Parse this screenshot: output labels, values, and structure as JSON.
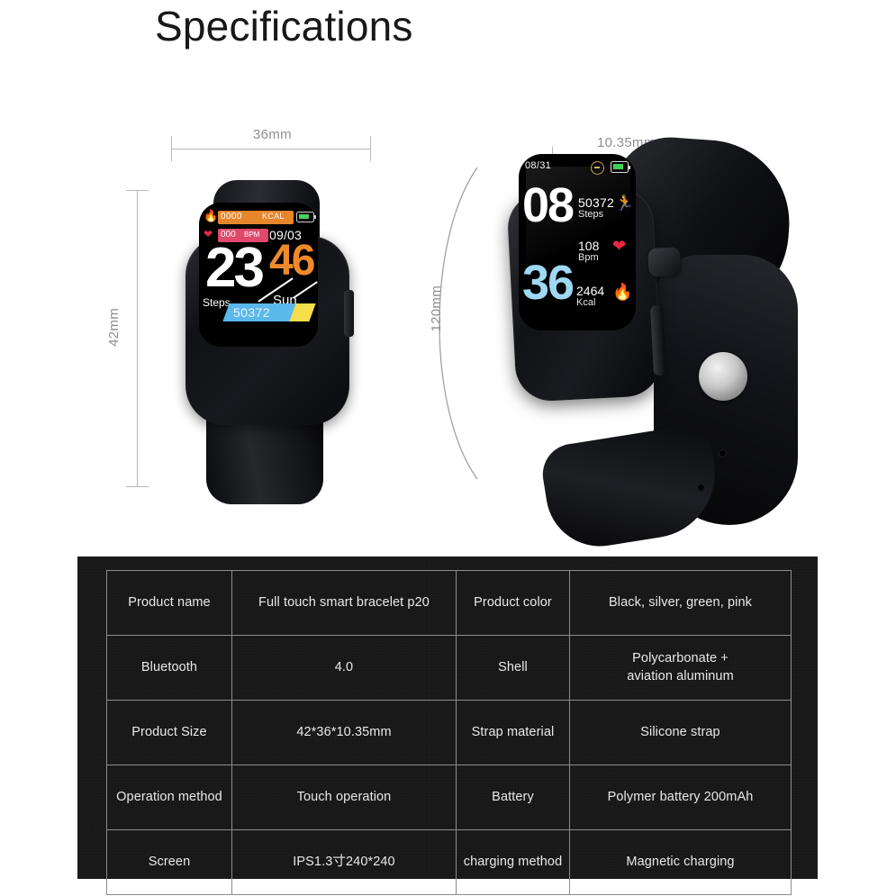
{
  "page": {
    "title": "Specifications",
    "background_color": "#ffffff",
    "panel_color": "#171717"
  },
  "dimensions": {
    "front_width": "36mm",
    "front_height": "42mm",
    "side_thickness": "10.35mm",
    "strap_length": "120mm"
  },
  "watch_front": {
    "kcal_value": "0000",
    "kcal_unit": "KCAL",
    "bpm_value": "000",
    "bpm_unit": "BPM",
    "date": "09/03",
    "hour": "23",
    "minute": "46",
    "weekday": "Sun",
    "steps_label": "Steps",
    "steps_value": "50372",
    "flame_icon": "flame-icon",
    "heart_icon": "heart-icon",
    "battery_icon": "battery-icon",
    "colors": {
      "kcal_bar": "#e8862c",
      "bpm_bar": "#e0486c",
      "steps_bar": "#5bb8ea",
      "accent_bar": "#f5dd4b",
      "minute": "#ef8a2a"
    }
  },
  "watch_side": {
    "date": "08/31",
    "hour": "08",
    "minute": "36",
    "steps_value": "50372",
    "steps_unit": "Steps",
    "bpm_value": "108",
    "bpm_unit": "Bpm",
    "kcal_value": "2464",
    "kcal_unit": "Kcal",
    "bluetooth_icon": "bluetooth-icon",
    "battery_icon": "battery-icon",
    "run_icon": "running-icon",
    "heart_icon": "heart-icon",
    "flame_icon": "flame-icon",
    "colors": {
      "minute": "#9fd8f2",
      "run_icon": "#49d96b",
      "heart_icon": "#e8293f",
      "flame_icon": "#4a63e8"
    }
  },
  "spec_table": {
    "rows": [
      {
        "label_left": "Product name",
        "value_left": "Full touch smart bracelet p20",
        "label_right": "Product color",
        "value_right": "Black, silver, green, pink"
      },
      {
        "label_left": "Bluetooth",
        "value_left": "4.0",
        "label_right": "Shell",
        "value_right": "Polycarbonate +\naviation aluminum"
      },
      {
        "label_left": "Product Size",
        "value_left": "42*36*10.35mm",
        "label_right": "Strap material",
        "value_right": "Silicone strap"
      },
      {
        "label_left": "Operation method",
        "value_left": "Touch operation",
        "label_right": "Battery",
        "value_right": "Polymer battery 200mAh"
      },
      {
        "label_left": "Screen",
        "value_left": "IPS1.3寸240*240",
        "label_right": "charging method",
        "value_right": "Magnetic charging"
      }
    ]
  }
}
